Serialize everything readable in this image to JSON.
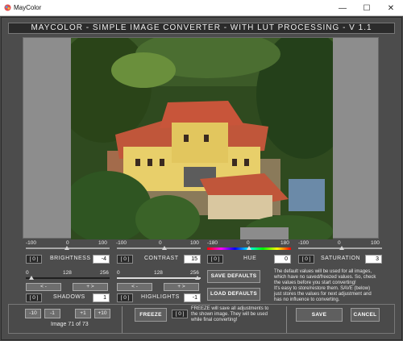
{
  "window": {
    "app_title": "MayColor",
    "header_title": "MAYCOLOR  -  SIMPLE IMAGE CONVERTER  -  WITH LUT PROCESSING  -  V 1.1"
  },
  "sliders": {
    "brightness": {
      "label": "BRIGHTNESS",
      "value": "-4",
      "reset": "[ 0 ]",
      "min": "-100",
      "mid": "0",
      "max": "100"
    },
    "contrast": {
      "label": "CONTRAST",
      "value": "15",
      "reset": "[ 0 ]",
      "min": "-100",
      "mid": "0",
      "max": "100"
    },
    "hue": {
      "label": "HUE",
      "value": "0",
      "reset": "[ 0 ]",
      "min": "-180",
      "mid": "0",
      "max": "180"
    },
    "saturation": {
      "label": "SATURATION",
      "value": "3",
      "reset": "[ 0 ]",
      "min": "-100",
      "mid": "0",
      "max": "100"
    },
    "shadows": {
      "label": "SHADOWS",
      "value": "1",
      "reset": "[ 0 ]",
      "min": "0",
      "mid": "128",
      "max": "256",
      "left_btn": "< -",
      "right_btn": "+ >"
    },
    "highlights": {
      "label": "HIGHLIGHTS",
      "value": "-1",
      "reset": "[ 0 ]",
      "min": "0",
      "mid": "128",
      "max": "256",
      "left_btn": "< -",
      "right_btn": "+ >"
    }
  },
  "defaults": {
    "save_label": "SAVE DEFAULTS",
    "load_label": "LOAD DEFAULTS",
    "note_lines": [
      "The default values will be used for all images,",
      "which have no saved/freezed values.  So, check",
      "the values before you start converting!",
      "It's easy to store/restore them. SAVE (below)",
      "just stores the values for next adjustment and",
      "has no influence to converting."
    ]
  },
  "footer": {
    "nav": {
      "minus10": "-10",
      "minus1": "-1",
      "plus1": "+1",
      "plus10": "+10"
    },
    "image_counter": "Image 71 of 73",
    "freeze_label": "FREEZE",
    "freeze_reset": "[ 0 ]",
    "freeze_note_lines": [
      "FREEZE will save all adjustments to",
      "the shown image. They will be used",
      "while final converting!"
    ],
    "save_label": "SAVE",
    "cancel_label": "CANCEL"
  },
  "colors": {
    "accent_hue_start": "#ff0000",
    "panel_bg": "#4c4c4c",
    "header_bg": "#2b2b2b"
  },
  "icons": {
    "app": "maycolor-app-icon",
    "minimize": "minimize-icon",
    "maximize": "maximize-icon",
    "close": "close-icon"
  }
}
